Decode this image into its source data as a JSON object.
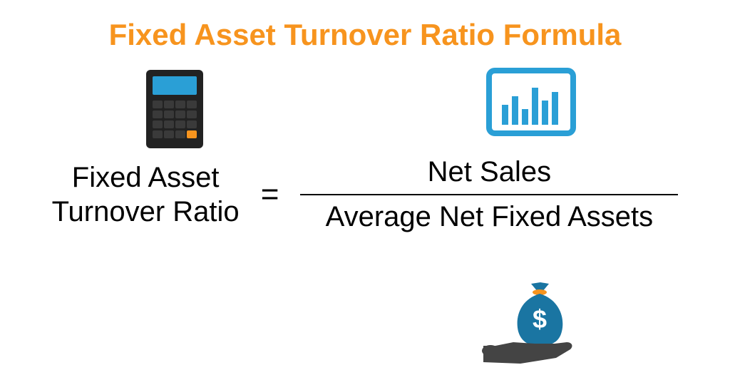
{
  "title": "Fixed Asset Turnover Ratio Formula",
  "formula": {
    "lhs_line1": "Fixed Asset",
    "lhs_line2": "Turnover Ratio",
    "equals": "=",
    "numerator": "Net Sales",
    "denominator": "Average Net Fixed Assets"
  },
  "colors": {
    "title": "#f7941e",
    "accent": "#2a9fd6",
    "dark": "#222222",
    "money_bag": "#1a75a2",
    "hand": "#444444"
  }
}
